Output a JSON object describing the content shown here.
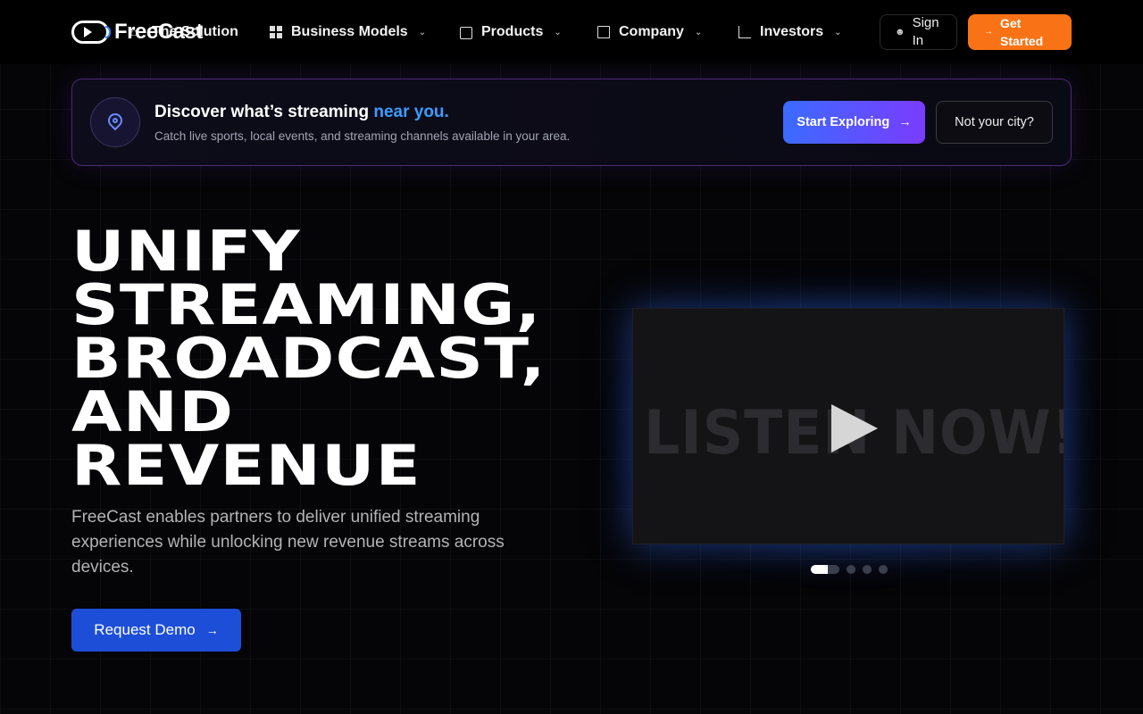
{
  "nav": {
    "logo_text": "FreeCast",
    "items": [
      {
        "label": "The Solution",
        "icon": "home-icon"
      },
      {
        "label": "Business Models",
        "icon": "grid-icon"
      },
      {
        "label": "Products",
        "icon": "tv-icon"
      },
      {
        "label": "Company",
        "icon": "building-icon"
      },
      {
        "label": "Investors",
        "icon": "chart-icon"
      }
    ],
    "sign_in": "Sign In",
    "get_started": "Get Started"
  },
  "banner": {
    "title": "Discover what’s streaming",
    "title_highlight": "near you.",
    "subtitle": "Catch live sports, local events, and streaming channels available in your area.",
    "explore_label": "Start Exploring",
    "city_label": "Not your city?"
  },
  "hero": {
    "title_lines": [
      "UNIFY",
      "STREAMING,",
      "BROADCAST,",
      "AND",
      "REVENUE"
    ],
    "subtitle": "FreeCast enables partners to deliver unified streaming experiences while unlocking new revenue streams across devices.",
    "cta": "Request Demo"
  },
  "video": {
    "overlay_text": "LISTEN NOW!",
    "slides": 4,
    "active_slide": 1
  },
  "colors": {
    "accent_orange": "#f97316",
    "accent_blue": "#1d4ed8",
    "highlight_blue": "#3b9cff"
  }
}
